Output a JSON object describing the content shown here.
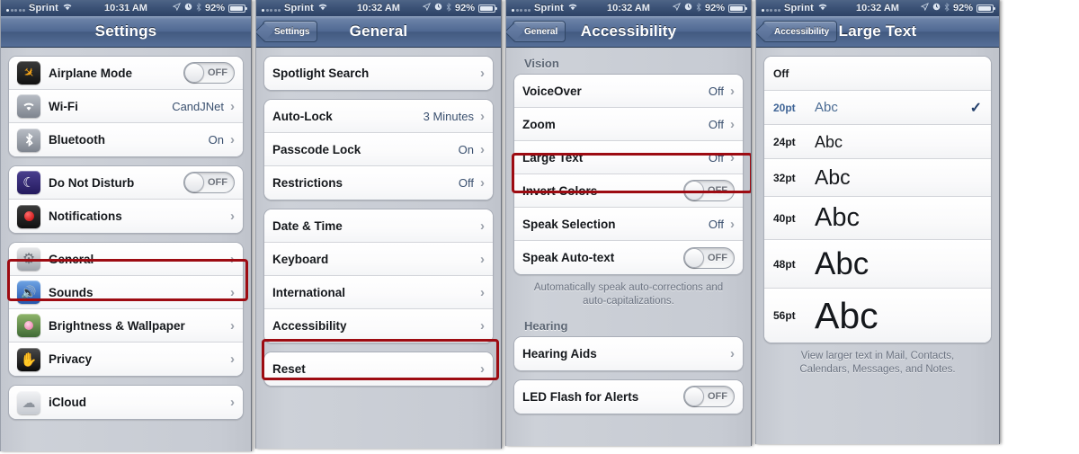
{
  "statusbar": {
    "carrier": "Sprint",
    "wifi_icon": "wifi-icon",
    "time_p1": "10:31 AM",
    "time_p2": "10:32 AM",
    "time_p3": "10:32 AM",
    "time_p4": "10:32 AM",
    "location_icon": "location-arrow-icon",
    "alarm_icon": "alarm-clock-icon",
    "bluetooth_icon": "bluetooth-icon",
    "battery_percent": "92%",
    "battery_icon": "battery-icon"
  },
  "panel1": {
    "nav": {
      "title": "Settings"
    },
    "groups": [
      {
        "rows": [
          {
            "icon": "airplane-icon",
            "label": "Airplane Mode",
            "control": "toggle",
            "toggle_state": "OFF"
          },
          {
            "icon": "wifi-icon",
            "label": "Wi-Fi",
            "value": "CandJNet",
            "control": "chevron"
          },
          {
            "icon": "bluetooth-icon",
            "label": "Bluetooth",
            "value": "On",
            "control": "chevron"
          }
        ]
      },
      {
        "rows": [
          {
            "icon": "moon-icon",
            "label": "Do Not Disturb",
            "control": "toggle",
            "toggle_state": "OFF"
          },
          {
            "icon": "notifications-icon",
            "label": "Notifications",
            "value": "",
            "control": "chevron"
          }
        ]
      },
      {
        "rows": [
          {
            "icon": "gear-icon",
            "label": "General",
            "value": "",
            "control": "chevron",
            "highlighted": true
          },
          {
            "icon": "speaker-icon",
            "label": "Sounds",
            "value": "",
            "control": "chevron"
          },
          {
            "icon": "wallpaper-icon",
            "label": "Brightness & Wallpaper",
            "value": "",
            "control": "chevron"
          },
          {
            "icon": "hand-icon",
            "label": "Privacy",
            "value": "",
            "control": "chevron"
          }
        ]
      },
      {
        "rows": [
          {
            "icon": "cloud-icon",
            "label": "iCloud",
            "value": "",
            "control": "chevron"
          }
        ]
      }
    ]
  },
  "panel2": {
    "nav": {
      "back": "Settings",
      "title": "General"
    },
    "groups": [
      {
        "rows": [
          {
            "label": "Spotlight Search",
            "value": "",
            "control": "chevron"
          }
        ]
      },
      {
        "rows": [
          {
            "label": "Auto-Lock",
            "value": "3 Minutes",
            "control": "chevron"
          },
          {
            "label": "Passcode Lock",
            "value": "On",
            "control": "chevron"
          },
          {
            "label": "Restrictions",
            "value": "Off",
            "control": "chevron"
          }
        ]
      },
      {
        "rows": [
          {
            "label": "Date & Time",
            "value": "",
            "control": "chevron"
          },
          {
            "label": "Keyboard",
            "value": "",
            "control": "chevron"
          },
          {
            "label": "International",
            "value": "",
            "control": "chevron"
          },
          {
            "label": "Accessibility",
            "value": "",
            "control": "chevron",
            "highlighted": true
          }
        ]
      },
      {
        "rows": [
          {
            "label": "Reset",
            "value": "",
            "control": "chevron"
          }
        ]
      }
    ]
  },
  "panel3": {
    "nav": {
      "back": "General",
      "title": "Accessibility"
    },
    "vision_header": "Vision",
    "vision_rows": [
      {
        "label": "VoiceOver",
        "value": "Off",
        "control": "chevron"
      },
      {
        "label": "Zoom",
        "value": "Off",
        "control": "chevron"
      },
      {
        "label": "Large Text",
        "value": "Off",
        "control": "chevron",
        "highlighted": true
      },
      {
        "label": "Invert Colors",
        "control": "toggle",
        "toggle_state": "OFF"
      },
      {
        "label": "Speak Selection",
        "value": "Off",
        "control": "chevron"
      },
      {
        "label": "Speak Auto-text",
        "control": "toggle",
        "toggle_state": "OFF"
      }
    ],
    "vision_footer": "Automatically speak auto-corrections and auto-capitalizations.",
    "hearing_header": "Hearing",
    "hearing_rows": [
      {
        "label": "Hearing Aids",
        "value": "",
        "control": "chevron"
      }
    ],
    "hearing_rows2": [
      {
        "label": "LED Flash for Alerts",
        "control": "toggle",
        "toggle_state": "OFF"
      }
    ]
  },
  "panel4": {
    "nav": {
      "back": "Accessibility",
      "title": "Large Text"
    },
    "rows": [
      {
        "pt": "Off",
        "sample": "",
        "selected": false,
        "size": 0
      },
      {
        "pt": "20pt",
        "sample": "Abc",
        "selected": true,
        "size": 15
      },
      {
        "pt": "24pt",
        "sample": "Abc",
        "selected": false,
        "size": 18
      },
      {
        "pt": "32pt",
        "sample": "Abc",
        "selected": false,
        "size": 23
      },
      {
        "pt": "40pt",
        "sample": "Abc",
        "selected": false,
        "size": 28
      },
      {
        "pt": "48pt",
        "sample": "Abc",
        "selected": false,
        "size": 33
      },
      {
        "pt": "56pt",
        "sample": "Abc",
        "selected": false,
        "size": 38
      }
    ],
    "checkmark": "✓",
    "footer": "View larger text in Mail, Contacts, Calendars, Messages, and Notes."
  },
  "colors": {
    "highlight": "#9d0b12",
    "nav_blue": "#4f6892",
    "value_blue": "#3a506f"
  }
}
